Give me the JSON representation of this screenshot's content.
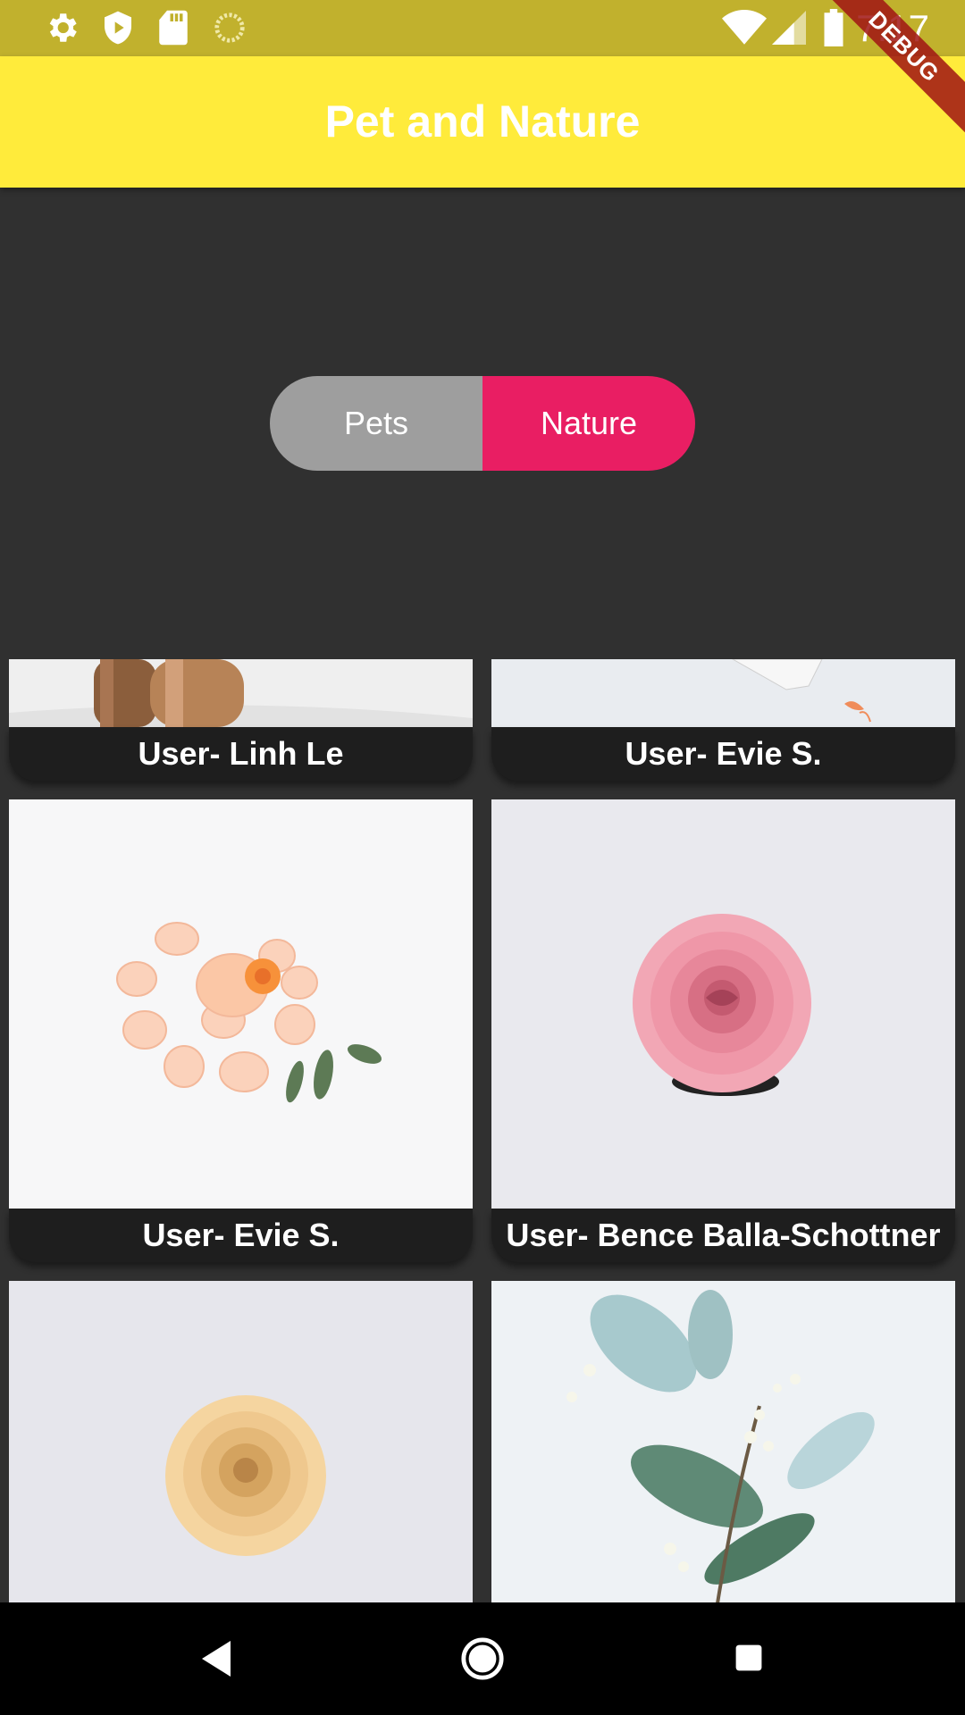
{
  "status_bar": {
    "time": "7:17",
    "icons_left": [
      "settings-icon",
      "shield-play-icon",
      "sd-card-icon",
      "loading-circle-icon"
    ],
    "icons_right": [
      "wifi-icon",
      "cell-signal-icon",
      "battery-icon"
    ]
  },
  "app_bar": {
    "title": "Pet and Nature",
    "color": "#ffeb3b"
  },
  "debug_banner": "DEBUG",
  "toggle": {
    "options": [
      "Pets",
      "Nature"
    ],
    "selected": "Nature",
    "inactive_color": "#9e9e9e",
    "active_color": "#e91e63"
  },
  "gallery": {
    "items": [
      {
        "user": "User- Linh Le",
        "image": "wooden-objects-photo"
      },
      {
        "user": "User- Evie S.",
        "image": "white-tabletop-photo"
      },
      {
        "user": "User- Evie S.",
        "image": "peach-petals-photo"
      },
      {
        "user": "User- Bence Balla-Schottner",
        "image": "pink-rose-photo"
      },
      {
        "user": "",
        "image": "yellow-rose-photo"
      },
      {
        "user": "",
        "image": "botanical-sprig-photo"
      }
    ]
  },
  "nav_bar": {
    "buttons": [
      "back-icon",
      "home-icon",
      "recents-icon"
    ]
  }
}
